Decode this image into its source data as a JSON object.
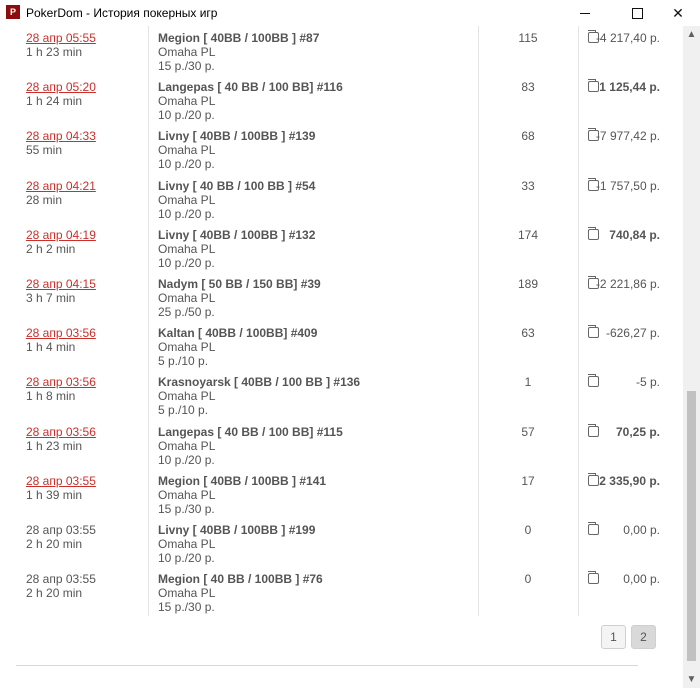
{
  "window": {
    "title": "PokerDom - История покерных игр",
    "icon_text": "P"
  },
  "rows": [
    {
      "date": "28 апр 05:55",
      "linked": true,
      "duration": "1 h 23 min",
      "table": "Megion [ 40BB / 100BB ] #87",
      "game": "Omaha PL",
      "stakes": "15 р./30 р.",
      "hands": "115",
      "result": "-4 217,40 р.",
      "bold": false
    },
    {
      "date": "28 апр 05:20",
      "linked": true,
      "duration": "1 h 24 min",
      "table": "Langepas [ 40 BB / 100 BB] #116",
      "game": "Omaha PL",
      "stakes": "10 р./20 р.",
      "hands": "83",
      "result": "1 125,44 р.",
      "bold": true
    },
    {
      "date": "28 апр 04:33",
      "linked": true,
      "duration": "55 min",
      "table": "Livny [ 40BB / 100BB ] #139",
      "game": "Omaha PL",
      "stakes": "10 р./20 р.",
      "hands": "68",
      "result": "-7 977,42 р.",
      "bold": false
    },
    {
      "date": "28 апр 04:21",
      "linked": true,
      "duration": "28 min",
      "table": "Livny [ 40 BB / 100 BB ] #54",
      "game": "Omaha PL",
      "stakes": "10 р./20 р.",
      "hands": "33",
      "result": "-1 757,50 р.",
      "bold": false
    },
    {
      "date": "28 апр 04:19",
      "linked": true,
      "duration": "2 h 2 min",
      "table": "Livny [ 40BB / 100BB ] #132",
      "game": "Omaha PL",
      "stakes": "10 р./20 р.",
      "hands": "174",
      "result": "740,84 р.",
      "bold": true
    },
    {
      "date": "28 апр 04:15",
      "linked": true,
      "duration": "3 h 7 min",
      "table": "Nadym [ 50 BB / 150 BB] #39",
      "game": "Omaha PL",
      "stakes": "25 р./50 р.",
      "hands": "189",
      "result": "-2 221,86 р.",
      "bold": false
    },
    {
      "date": "28 апр 03:56",
      "linked": true,
      "duration": "1 h 4 min",
      "table": "Kaltan [ 40BB / 100BB] #409",
      "game": "Omaha PL",
      "stakes": "5 р./10 р.",
      "hands": "63",
      "result": "-626,27 р.",
      "bold": false
    },
    {
      "date": "28 апр 03:56",
      "linked": true,
      "duration": "1 h 8 min",
      "table": "Krasnoyarsk [ 40BB / 100 BB ] #136",
      "game": "Omaha PL",
      "stakes": "5 р./10 р.",
      "hands": "1",
      "result": "-5 р.",
      "bold": false
    },
    {
      "date": "28 апр 03:56",
      "linked": true,
      "duration": "1 h 23 min",
      "table": "Langepas [ 40 BB / 100 BB] #115",
      "game": "Omaha PL",
      "stakes": "10 р./20 р.",
      "hands": "57",
      "result": "70,25 р.",
      "bold": true
    },
    {
      "date": "28 апр 03:55",
      "linked": true,
      "duration": "1 h 39 min",
      "table": "Megion [ 40BB / 100BB ] #141",
      "game": "Omaha PL",
      "stakes": "15 р./30 р.",
      "hands": "17",
      "result": "2 335,90 р.",
      "bold": true
    },
    {
      "date": "28 апр 03:55",
      "linked": false,
      "duration": "2 h 20 min",
      "table": "Livny [ 40BB / 100BB ] #199",
      "game": "Omaha PL",
      "stakes": "10 р./20 р.",
      "hands": "0",
      "result": "0,00 р.",
      "bold": false
    },
    {
      "date": "28 апр 03:55",
      "linked": false,
      "duration": "2 h 20 min",
      "table": "Megion [ 40 BB / 100BB ] #76",
      "game": "Omaha PL",
      "stakes": "15 р./30 р.",
      "hands": "0",
      "result": "0,00 р.",
      "bold": false
    }
  ],
  "pagination": {
    "pages": [
      "1",
      "2"
    ],
    "current": "2"
  },
  "colors": {
    "link_red": "#c9302c",
    "text_gray": "#555555"
  },
  "icons": {
    "result": "wallet-icon",
    "minimize": "minimize-icon",
    "maximize": "maximize-icon",
    "close": "close-icon"
  }
}
